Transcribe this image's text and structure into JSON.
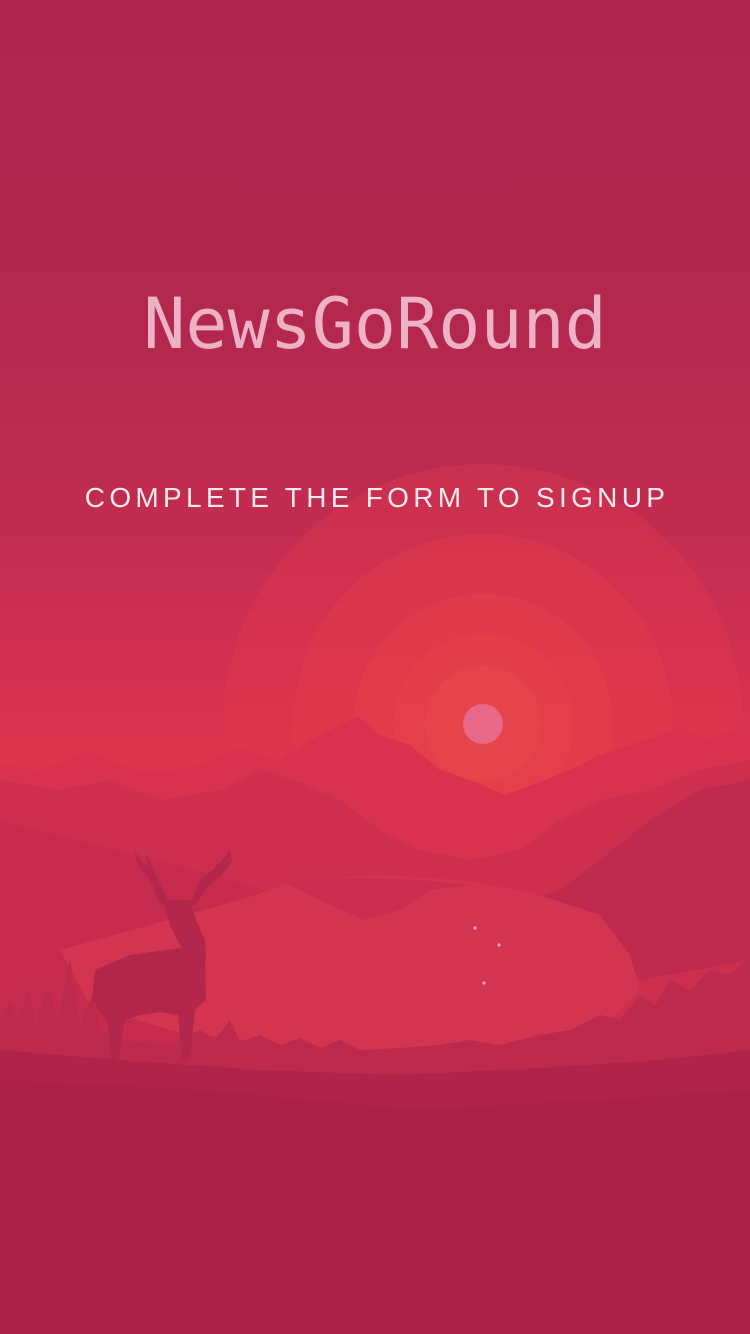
{
  "app": {
    "title": "NewsGoRound",
    "subtitle": "COMPLETE THE FORM TO SIGNUP"
  },
  "colors": {
    "background_top": "#ae2550",
    "background_mid": "#e03a48",
    "background_bottom": "#ab214a",
    "title_color": "#eeb1c6",
    "subtitle_color": "#fbe9ee",
    "sun_color": "#e8688a"
  },
  "scene": {
    "illustration": "sunset-mountain-lake-with-deer"
  }
}
